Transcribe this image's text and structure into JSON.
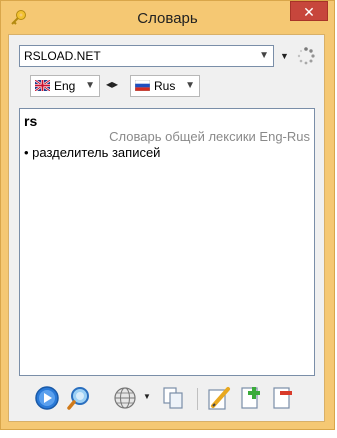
{
  "window": {
    "title": "Словарь",
    "close_label": "✕"
  },
  "combo": {
    "value": "RSLOAD.NET"
  },
  "langs": {
    "source": "Eng",
    "target": "Rus",
    "swap_label": "◂▸"
  },
  "article": {
    "headword": "rs",
    "dictionary": "Словарь общей лексики Eng-Rus",
    "definition": "• разделитель записей"
  },
  "icons": {
    "title": "key-icon",
    "spinner": "loading-spinner-icon",
    "toolbar": [
      "play-icon",
      "search-icon",
      "globe-icon",
      "copy-icon",
      "edit-icon",
      "add-icon",
      "delete-icon"
    ]
  }
}
